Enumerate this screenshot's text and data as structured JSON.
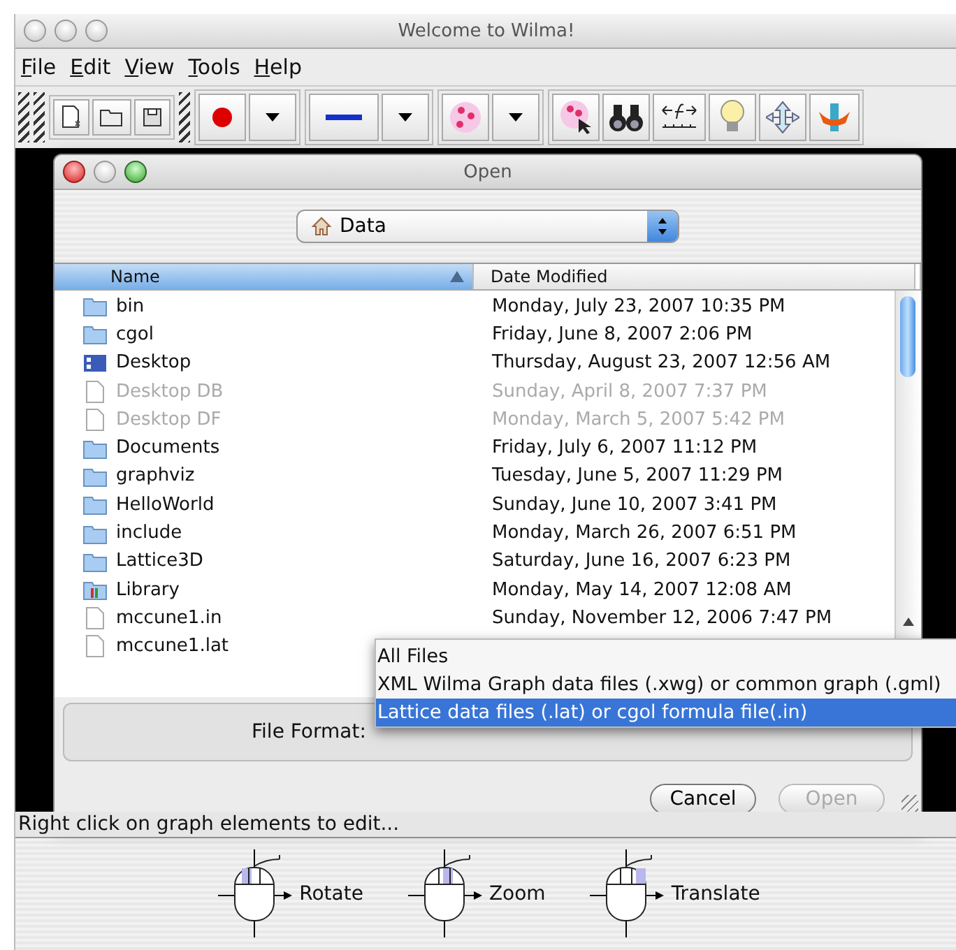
{
  "window": {
    "title": "Welcome to Wilma!"
  },
  "menu": [
    {
      "label": "File"
    },
    {
      "label": "Edit"
    },
    {
      "label": "View"
    },
    {
      "label": "Tools"
    },
    {
      "label": "Help"
    }
  ],
  "dialog": {
    "title": "Open",
    "location": "Data",
    "columns": [
      {
        "label": "Name",
        "sorted": true
      },
      {
        "label": "Date Modified",
        "sorted": false
      }
    ],
    "files": [
      {
        "name": "bin",
        "date": "Monday, July 23, 2007 10:35 PM",
        "kind": "folder",
        "disabled": false
      },
      {
        "name": "cgol",
        "date": "Friday, June 8, 2007 2:06 PM",
        "kind": "folder",
        "disabled": false
      },
      {
        "name": "Desktop",
        "date": "Thursday, August 23, 2007 12:56 AM",
        "kind": "desktop",
        "disabled": false
      },
      {
        "name": "Desktop DB",
        "date": "Sunday, April 8, 2007 7:37 PM",
        "kind": "file",
        "disabled": true
      },
      {
        "name": "Desktop DF",
        "date": "Monday, March 5, 2007 5:42 PM",
        "kind": "file",
        "disabled": true
      },
      {
        "name": "Documents",
        "date": "Friday, July 6, 2007 11:12 PM",
        "kind": "folder",
        "disabled": false
      },
      {
        "name": "graphviz",
        "date": "Tuesday, June 5, 2007 11:29 PM",
        "kind": "folder",
        "disabled": false
      },
      {
        "name": "HelloWorld",
        "date": "Sunday, June 10, 2007 3:41 PM",
        "kind": "folder",
        "disabled": false
      },
      {
        "name": "include",
        "date": "Monday, March 26, 2007 6:51 PM",
        "kind": "folder",
        "disabled": false
      },
      {
        "name": "Lattice3D",
        "date": "Saturday, June 16, 2007 6:23 PM",
        "kind": "folder",
        "disabled": false
      },
      {
        "name": "Library",
        "date": "Monday, May 14, 2007 12:08 AM",
        "kind": "library",
        "disabled": false
      },
      {
        "name": "mccune1.in",
        "date": "Sunday, November 12, 2006 7:47 PM",
        "kind": "file",
        "disabled": false
      },
      {
        "name": "mccune1.lat",
        "kind": "file",
        "disabled": false
      }
    ],
    "format_label": "File Format:",
    "format_options": [
      {
        "label": "All Files",
        "selected": false
      },
      {
        "label": "XML Wilma Graph data files (.xwg) or common graph (.gml)",
        "selected": false
      },
      {
        "label": "Lattice data files (.lat) or cgol formula file(.in)",
        "selected": true
      }
    ],
    "buttons": [
      {
        "label": "Cancel",
        "disabled": false
      },
      {
        "label": "Open",
        "disabled": true
      }
    ]
  },
  "status_bar": "Right click on graph elements to edit...",
  "mouse_hints": [
    {
      "label": "Rotate",
      "kind": "left"
    },
    {
      "label": "Zoom",
      "kind": "middle"
    },
    {
      "label": "Translate",
      "kind": "right"
    }
  ]
}
